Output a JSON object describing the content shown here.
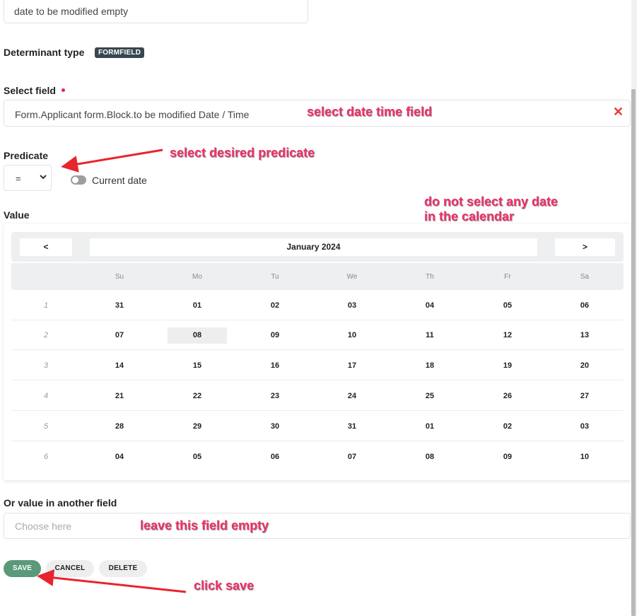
{
  "form": {
    "name_value": "date to be modified empty",
    "determinant_label": "Determinant type",
    "determinant_badge": "FORMFIELD",
    "select_field_label": "Select field",
    "select_field_value": "Form.Applicant form.Block.to be modified Date / Time",
    "predicate_label": "Predicate",
    "predicate_value": "=",
    "current_date_label": "Current date",
    "value_label": "Value",
    "other_field_label": "Or value in another field",
    "other_field_placeholder": "Choose here",
    "other_field_value": ""
  },
  "calendar": {
    "prev_label": "<",
    "next_label": ">",
    "month_title": "January 2024",
    "weekdays": [
      "Su",
      "Mo",
      "Tu",
      "We",
      "Th",
      "Fr",
      "Sa"
    ],
    "weeks": [
      {
        "no": "1",
        "days": [
          "31",
          "01",
          "02",
          "03",
          "04",
          "05",
          "06"
        ]
      },
      {
        "no": "2",
        "days": [
          "07",
          "08",
          "09",
          "10",
          "11",
          "12",
          "13"
        ]
      },
      {
        "no": "3",
        "days": [
          "14",
          "15",
          "16",
          "17",
          "18",
          "19",
          "20"
        ]
      },
      {
        "no": "4",
        "days": [
          "21",
          "22",
          "23",
          "24",
          "25",
          "26",
          "27"
        ]
      },
      {
        "no": "5",
        "days": [
          "28",
          "29",
          "30",
          "31",
          "01",
          "02",
          "03"
        ]
      },
      {
        "no": "6",
        "days": [
          "04",
          "05",
          "06",
          "07",
          "08",
          "09",
          "10"
        ]
      }
    ],
    "highlighted_day": "08"
  },
  "actions": {
    "save_label": "SAVE",
    "cancel_label": "CANCEL",
    "delete_label": "DELETE"
  },
  "annotations": {
    "select_field_note": "select date time field",
    "predicate_note": "select desired predicate",
    "calendar_note_line1": "do not select any date",
    "calendar_note_line2": "in the calendar",
    "other_field_note": "leave this field empty",
    "save_note": "click save"
  },
  "colors": {
    "annotation": "#ee2f66",
    "arrow": "#e8242c",
    "save_button": "#5a9a7a",
    "badge": "#37474f",
    "clear_icon": "#e53935"
  }
}
